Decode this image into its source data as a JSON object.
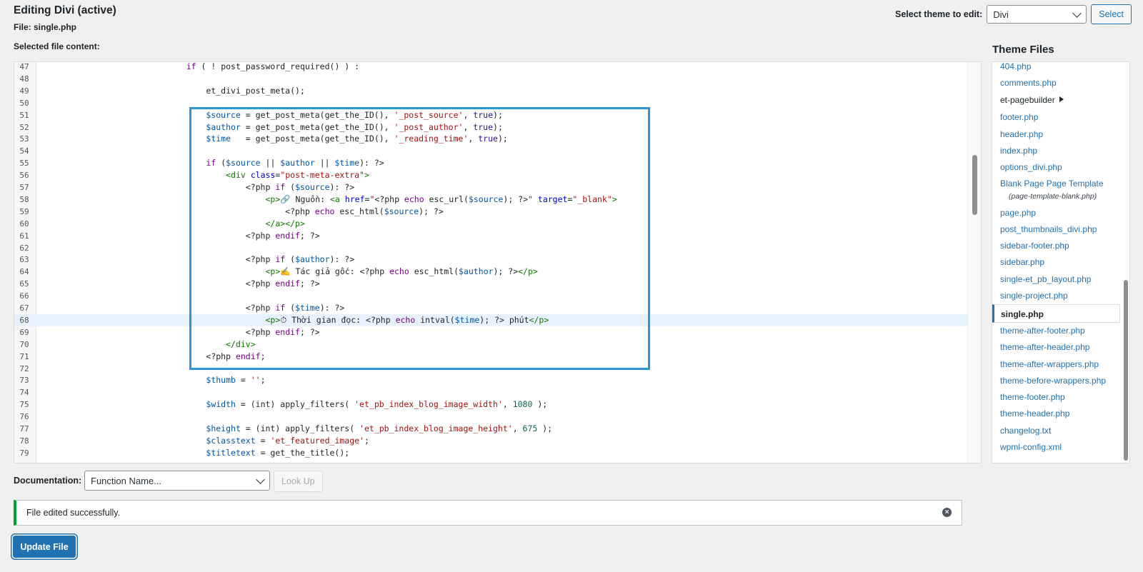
{
  "header": {
    "title": "Editing Divi (active)",
    "file_label": "File: single.php",
    "selected_label": "Selected file content:",
    "select_theme_label": "Select theme to edit:",
    "theme_value": "Divi",
    "select_button": "Select"
  },
  "editor": {
    "active_line": 68,
    "lines": [
      {
        "n": "47",
        "html": "                              <span class=\"kw\">if</span> ( ! post_password_required() ) :"
      },
      {
        "n": "48",
        "html": ""
      },
      {
        "n": "49",
        "html": "                                  et_divi_post_meta();"
      },
      {
        "n": "50",
        "html": ""
      },
      {
        "n": "51",
        "html": "                                  <span class=\"var\">$source</span> = get_post_meta(get_the_ID(), <span class=\"str\">'_post_source'</span>, <span class=\"atom\">true</span>);"
      },
      {
        "n": "52",
        "html": "                                  <span class=\"var\">$author</span> = get_post_meta(get_the_ID(), <span class=\"str\">'_post_author'</span>, <span class=\"atom\">true</span>);"
      },
      {
        "n": "53",
        "html": "                                  <span class=\"var\">$time</span>   = get_post_meta(get_the_ID(), <span class=\"str\">'_reading_time'</span>, <span class=\"atom\">true</span>);"
      },
      {
        "n": "54",
        "html": ""
      },
      {
        "n": "55",
        "html": "                                  <span class=\"kw\">if</span> (<span class=\"var\">$source</span> || <span class=\"var\">$author</span> || <span class=\"var\">$time</span>): ?&gt;"
      },
      {
        "n": "56",
        "html": "                                      <span class=\"tag\">&lt;div</span> <span class=\"attr\">class</span>=<span class=\"str\">\"post-meta-extra\"</span><span class=\"tag\">&gt;</span>"
      },
      {
        "n": "57",
        "html": "                                          &lt;?php <span class=\"kw\">if</span> (<span class=\"var\">$source</span>): ?&gt;"
      },
      {
        "n": "58",
        "html": "                                              <span class=\"tag\">&lt;p&gt;</span>🔗 Nguồn: <span class=\"tag\">&lt;a</span> <span class=\"attr\">href</span>=<span class=\"str\">\"</span>&lt;?php <span class=\"kw\">echo</span> esc_url(<span class=\"var\">$source</span>); ?&gt;<span class=\"str\">\"</span> <span class=\"attr\">target</span>=<span class=\"str\">\"_blank\"</span><span class=\"tag\">&gt;</span>"
      },
      {
        "n": "59",
        "html": "                                                  &lt;?php <span class=\"kw\">echo</span> esc_html(<span class=\"var\">$source</span>); ?&gt;"
      },
      {
        "n": "60",
        "html": "                                              <span class=\"tag\">&lt;/a&gt;&lt;/p&gt;</span>"
      },
      {
        "n": "61",
        "html": "                                          &lt;?php <span class=\"kw\">endif</span>; ?&gt;"
      },
      {
        "n": "62",
        "html": ""
      },
      {
        "n": "63",
        "html": "                                          &lt;?php <span class=\"kw\">if</span> (<span class=\"var\">$author</span>): ?&gt;"
      },
      {
        "n": "64",
        "html": "                                              <span class=\"tag\">&lt;p&gt;</span>✍️ Tác giả gốc: &lt;?php <span class=\"kw\">echo</span> esc_html(<span class=\"var\">$author</span>); ?&gt;<span class=\"tag\">&lt;/p&gt;</span>"
      },
      {
        "n": "65",
        "html": "                                          &lt;?php <span class=\"kw\">endif</span>; ?&gt;"
      },
      {
        "n": "66",
        "html": ""
      },
      {
        "n": "67",
        "html": "                                          &lt;?php <span class=\"kw\">if</span> (<span class=\"var\">$time</span>): ?&gt;"
      },
      {
        "n": "68",
        "html": "                                              <span class=\"tag\">&lt;p&gt;</span>⏱ Thời gian đọc: &lt;?php <span class=\"kw\">echo</span> intval(<span class=\"var\">$time</span>); ?&gt; phút<span class=\"tag\">&lt;/p&gt;</span>"
      },
      {
        "n": "69",
        "html": "                                          &lt;?php <span class=\"kw\">endif</span>; ?&gt;"
      },
      {
        "n": "70",
        "html": "                                      <span class=\"tag\">&lt;/div&gt;</span>"
      },
      {
        "n": "71",
        "html": "                                  &lt;?php <span class=\"kw\">endif</span>;"
      },
      {
        "n": "72",
        "html": ""
      },
      {
        "n": "73",
        "html": "                                  <span class=\"var\">$thumb</span> = <span class=\"str\">''</span>;"
      },
      {
        "n": "74",
        "html": ""
      },
      {
        "n": "75",
        "html": "                                  <span class=\"var\">$width</span> = (int) apply_filters( <span class=\"str\">'et_pb_index_blog_image_width'</span>, <span class=\"num\">1080</span> );"
      },
      {
        "n": "76",
        "html": ""
      },
      {
        "n": "77",
        "html": "                                  <span class=\"var\">$height</span> = (int) apply_filters( <span class=\"str\">'et_pb_index_blog_image_height'</span>, <span class=\"num\">675</span> );"
      },
      {
        "n": "78",
        "html": "                                  <span class=\"var\">$classtext</span> = <span class=\"str\">'et_featured_image'</span>;"
      },
      {
        "n": "79",
        "html": "                                  <span class=\"var\">$titletext</span> = get_the_title();"
      }
    ]
  },
  "sidebar": {
    "heading": "Theme Files",
    "files": [
      {
        "label": "404.php"
      },
      {
        "label": "comments.php"
      },
      {
        "label": "et-pagebuilder",
        "folder": true
      },
      {
        "label": "footer.php"
      },
      {
        "label": "header.php"
      },
      {
        "label": "index.php"
      },
      {
        "label": "options_divi.php"
      },
      {
        "label": "Blank Page Page Template",
        "sub": "(page-template-blank.php)"
      },
      {
        "label": "page.php"
      },
      {
        "label": "post_thumbnails_divi.php"
      },
      {
        "label": "sidebar-footer.php"
      },
      {
        "label": "sidebar.php"
      },
      {
        "label": "single-et_pb_layout.php"
      },
      {
        "label": "single-project.php"
      },
      {
        "label": "single.php",
        "current": true
      },
      {
        "label": "theme-after-footer.php"
      },
      {
        "label": "theme-after-header.php"
      },
      {
        "label": "theme-after-wrappers.php"
      },
      {
        "label": "theme-before-wrappers.php"
      },
      {
        "label": "theme-footer.php"
      },
      {
        "label": "theme-header.php"
      },
      {
        "label": "changelog.txt"
      },
      {
        "label": "wpml-config.xml"
      }
    ]
  },
  "documentation": {
    "label": "Documentation:",
    "select_value": "Function Name...",
    "lookup_button": "Look Up"
  },
  "notice": {
    "text": "File edited successfully.",
    "color": "#00a32a"
  },
  "update_button": "Update File",
  "colors": {
    "accent": "#2271b1",
    "highlight_box": "#2b95d6"
  }
}
